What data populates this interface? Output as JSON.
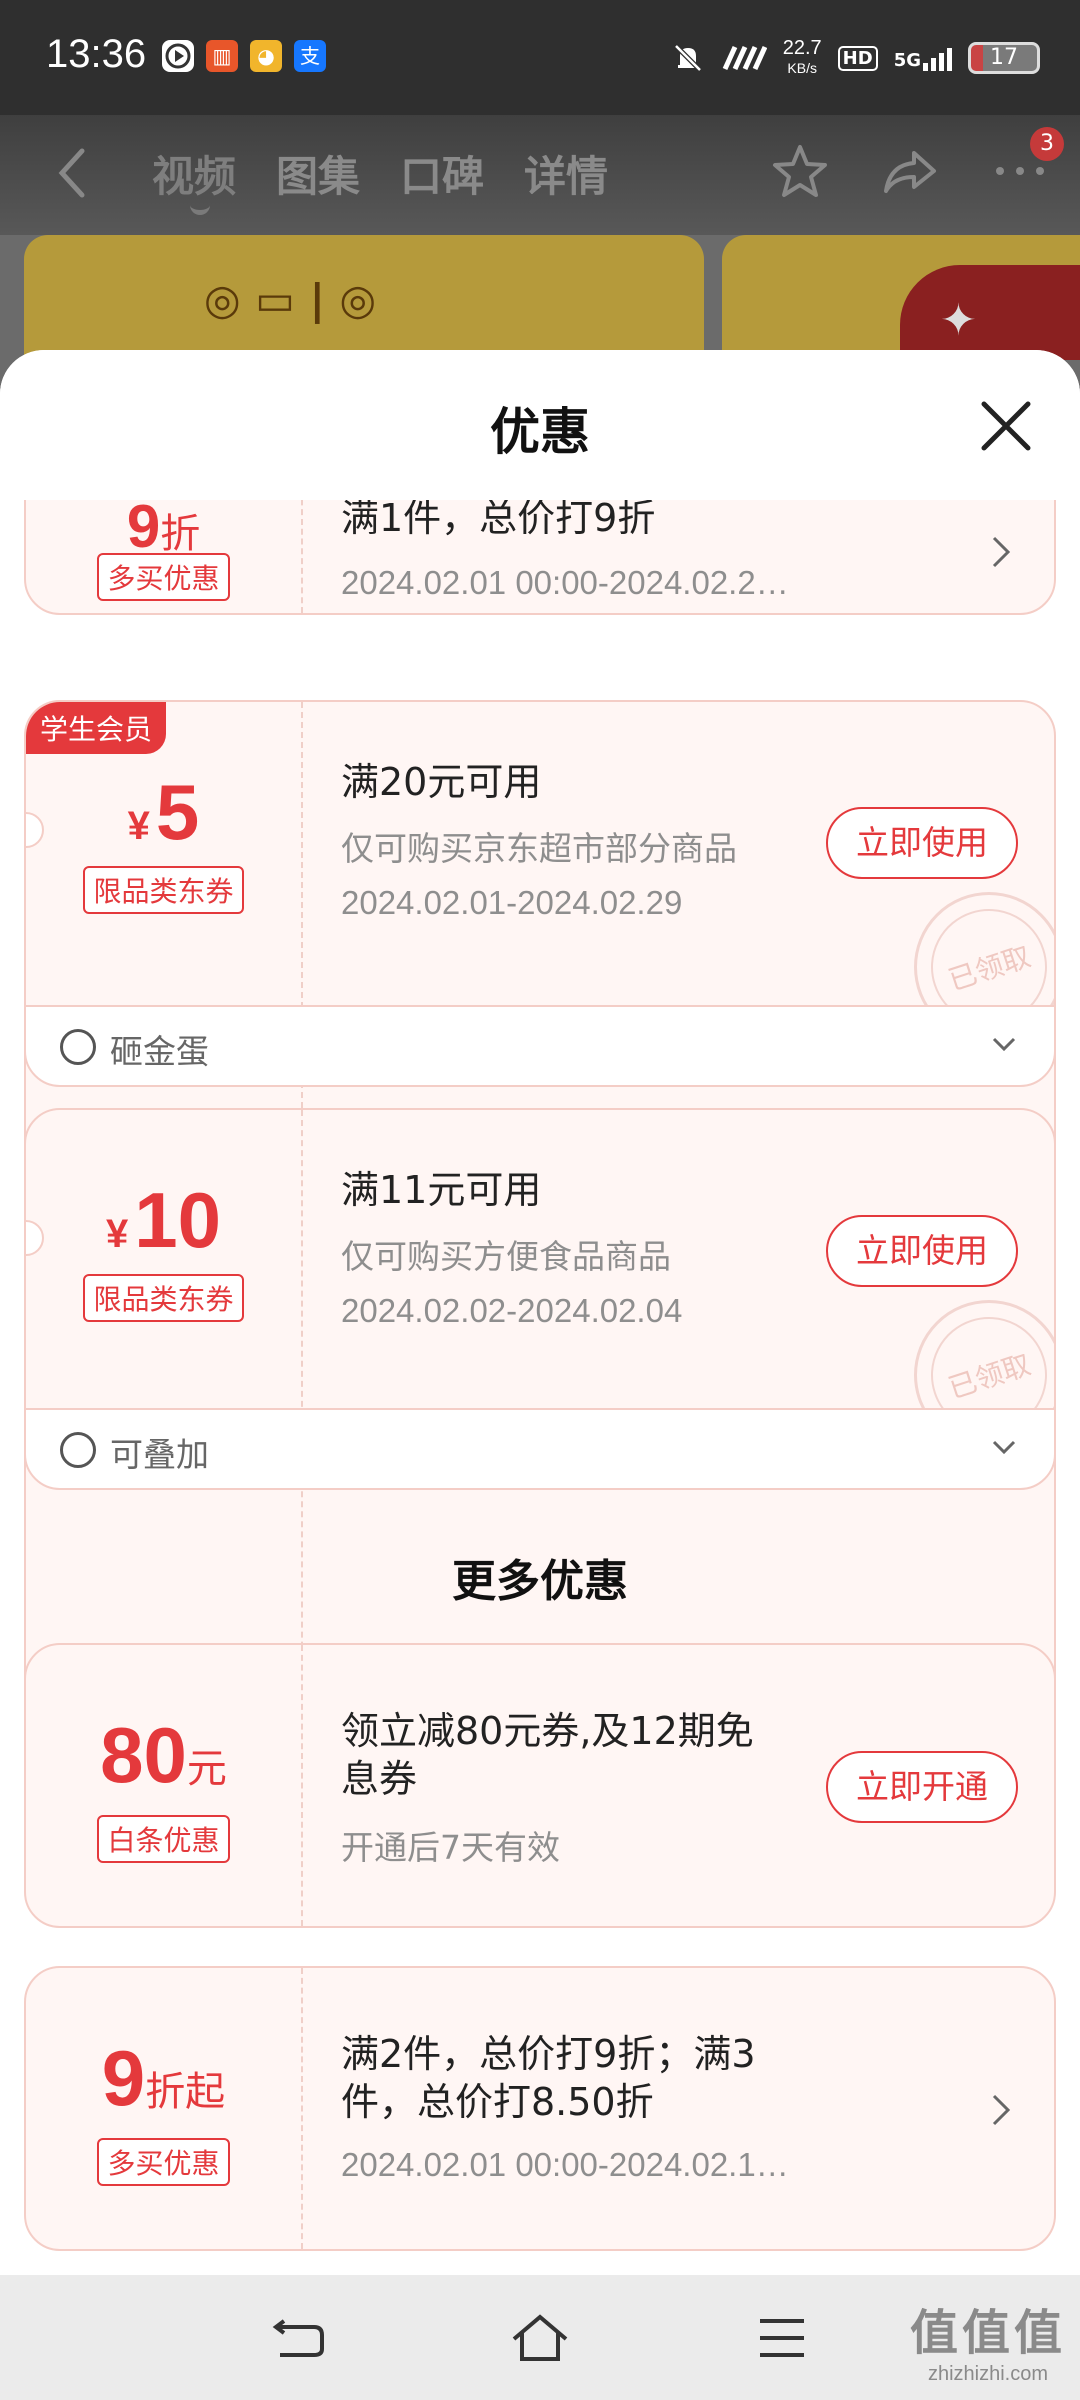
{
  "status_bar": {
    "time": "13:36",
    "app_icons": [
      "play-icon",
      "app-red-icon",
      "app-yellow-icon",
      "alipay-icon"
    ],
    "net_speed_value": "22.7",
    "net_speed_unit": "KB/s",
    "hd_label": "HD",
    "network_label": "5G",
    "battery": "17"
  },
  "top_nav": {
    "tabs": [
      {
        "label": "视频",
        "active": true
      },
      {
        "label": "图集",
        "active": false
      },
      {
        "label": "口碑",
        "active": false
      },
      {
        "label": "详情",
        "active": false
      }
    ],
    "badge_count": "3"
  },
  "sheet": {
    "title": "优惠",
    "coupons": [
      {
        "amount_num": "9",
        "amount_unit": "折",
        "tag": "多买优惠",
        "condition": "满1件，总价打9折",
        "date": "2024.02.01 00:00-2024.02.2…"
      },
      {
        "student_tag": "学生会员",
        "currency": "¥",
        "amount_num": "5",
        "tag": "限品类东券",
        "condition": "满20元可用",
        "sub": "仅可购买京东超市部分商品",
        "date": "2024.02.01-2024.02.29",
        "button": "立即使用",
        "stamp": "已领取",
        "footer": "砸金蛋"
      },
      {
        "currency": "¥",
        "amount_num": "10",
        "tag": "限品类东券",
        "condition": "满11元可用",
        "sub": "仅可购买方便食品商品",
        "date": "2024.02.02-2024.02.04",
        "button": "立即使用",
        "stamp": "已领取",
        "footer": "可叠加"
      }
    ],
    "more_title": "更多优惠",
    "more": [
      {
        "amount_num": "80",
        "amount_unit": "元",
        "tag": "白条优惠",
        "condition_line1": "领立减80元券,及12期免",
        "condition_line2": "息券",
        "sub": "开通后7天有效",
        "button": "立即开通"
      },
      {
        "amount_num": "9",
        "amount_unit": "折起",
        "tag": "多买优惠",
        "condition_line1": "满2件，总价打9折；满3",
        "condition_line2": "件，总价打8.50折",
        "date": "2024.02.01 00:00-2024.02.1…"
      }
    ]
  },
  "watermark": {
    "text": "值值值",
    "domain": "zhizhizhi.com"
  },
  "colors": {
    "accent": "#e4393c",
    "card_bg": "#fff6f4",
    "card_border": "#f4cdc6"
  }
}
